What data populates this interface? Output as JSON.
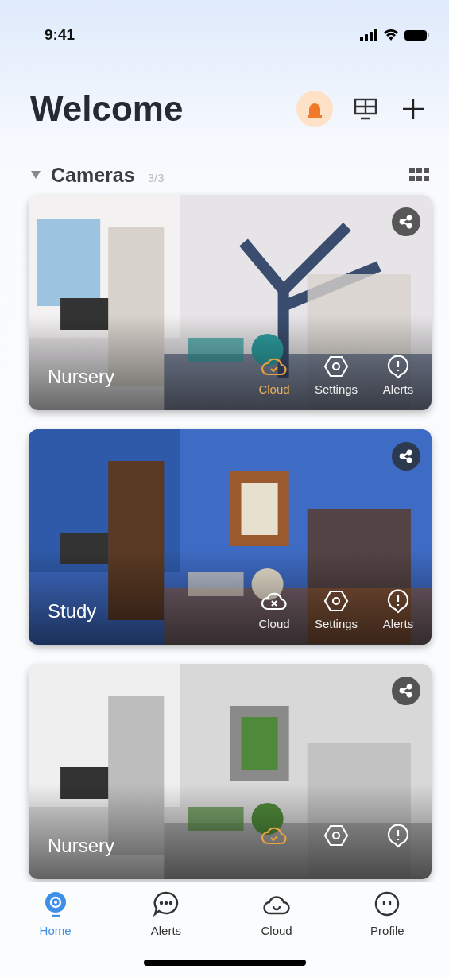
{
  "status_bar": {
    "time": "9:41"
  },
  "header": {
    "title": "Welcome",
    "alarm_on": true
  },
  "section": {
    "title": "Cameras",
    "count": "3/3",
    "expanded": true
  },
  "cameras": [
    {
      "name": "Nursery",
      "cloud_synced": true,
      "actions": [
        {
          "kind": "cloud",
          "label": "Cloud"
        },
        {
          "kind": "settings",
          "label": "Settings"
        },
        {
          "kind": "alerts",
          "label": "Alerts"
        }
      ]
    },
    {
      "name": "Study",
      "cloud_synced": false,
      "actions": [
        {
          "kind": "cloud",
          "label": "Cloud"
        },
        {
          "kind": "settings",
          "label": "Settings"
        },
        {
          "kind": "alerts",
          "label": "Alerts"
        }
      ]
    },
    {
      "name": "Nursery",
      "cloud_synced": true,
      "actions": [
        {
          "kind": "cloud"
        },
        {
          "kind": "settings"
        },
        {
          "kind": "alerts"
        }
      ]
    }
  ],
  "tabs": [
    {
      "kind": "home",
      "label": "Home",
      "selected": true
    },
    {
      "kind": "alerts",
      "label": "Alerts",
      "selected": false
    },
    {
      "kind": "cloud",
      "label": "Cloud",
      "selected": false
    },
    {
      "kind": "profile",
      "label": "Profile",
      "selected": false
    }
  ]
}
